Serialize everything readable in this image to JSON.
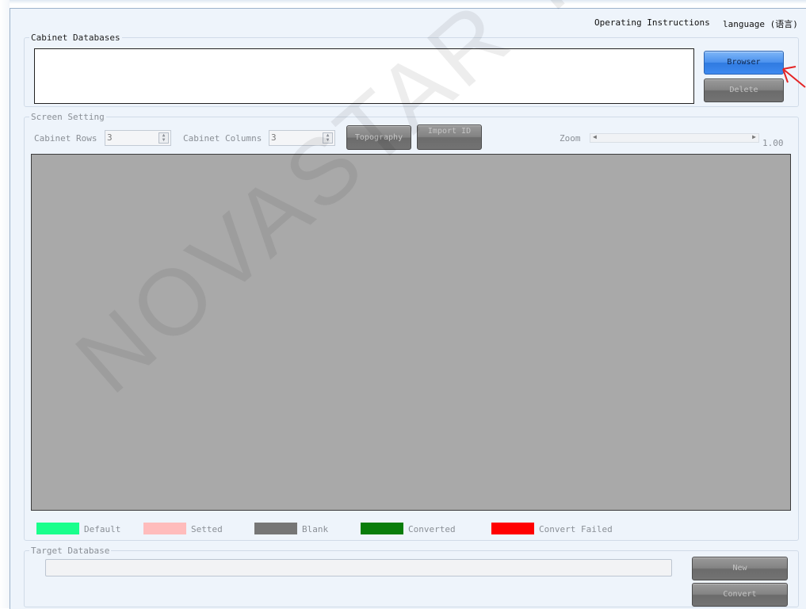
{
  "header": {
    "operating_instructions": "Operating Instructions",
    "language": "language (语言)"
  },
  "cabinet_databases": {
    "legend": "Cabinet Databases",
    "browser_label": "Browser",
    "delete_label": "Delete"
  },
  "screen_setting": {
    "legend": "Screen Setting",
    "rows_label": "Cabinet Rows",
    "rows_value": "3",
    "columns_label": "Cabinet Columns",
    "columns_value": "3",
    "topography_label": "Topography",
    "import_id_label": "Import ID",
    "zoom_label": "Zoom",
    "zoom_value": "1.00"
  },
  "legend_items": [
    {
      "label": "Default",
      "color": "#19ff8c"
    },
    {
      "label": "Setted",
      "color": "#ffbcbc"
    },
    {
      "label": "Blank",
      "color": "#767676"
    },
    {
      "label": "Converted",
      "color": "#0a7d0a"
    },
    {
      "label": "Convert Failed",
      "color": "#ff0000"
    }
  ],
  "target_database": {
    "legend": "Target Database",
    "new_label": "New",
    "convert_label": "Convert"
  },
  "watermark": "NOVASTAR TECH CO.,LTD"
}
